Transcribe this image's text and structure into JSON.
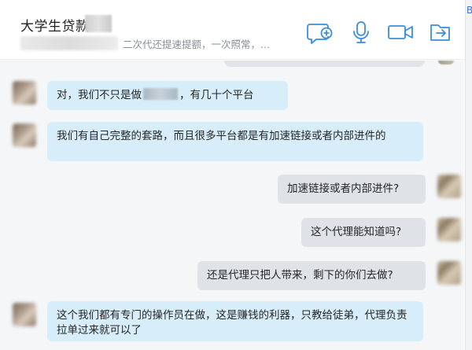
{
  "header": {
    "title": "大学生贷款",
    "subtitle": "二次代还提速提额，一次照常，..."
  },
  "toolbar": {
    "icons": [
      "chat-add-icon",
      "microphone-icon",
      "video-camera-icon",
      "share-forward-icon"
    ]
  },
  "edge_char": "B",
  "messages": [
    {
      "side": "in",
      "parts": {
        "before": "对，我们不只是做",
        "after": "，有几十个平台"
      }
    },
    {
      "side": "in",
      "text": "我们有自己完整的套路，而且很多平台都是有加速链接或者内部进件的"
    },
    {
      "side": "out",
      "text": "加速链接或者内部进件?"
    },
    {
      "side": "out",
      "text": "这个代理能知道吗?"
    },
    {
      "side": "out",
      "text": "还是代理只把人带来，剩下的你们去做?"
    },
    {
      "side": "in",
      "text": "这个我们都有专门的操作员在做，这是赚钱的利器，只教给徒弟，代理负责拉单过来就可以了"
    }
  ],
  "colors": {
    "incoming_bubble": "#d7eefa",
    "outgoing_bubble": "#dfe3e8",
    "icon_accent": "#3b8fd8"
  }
}
